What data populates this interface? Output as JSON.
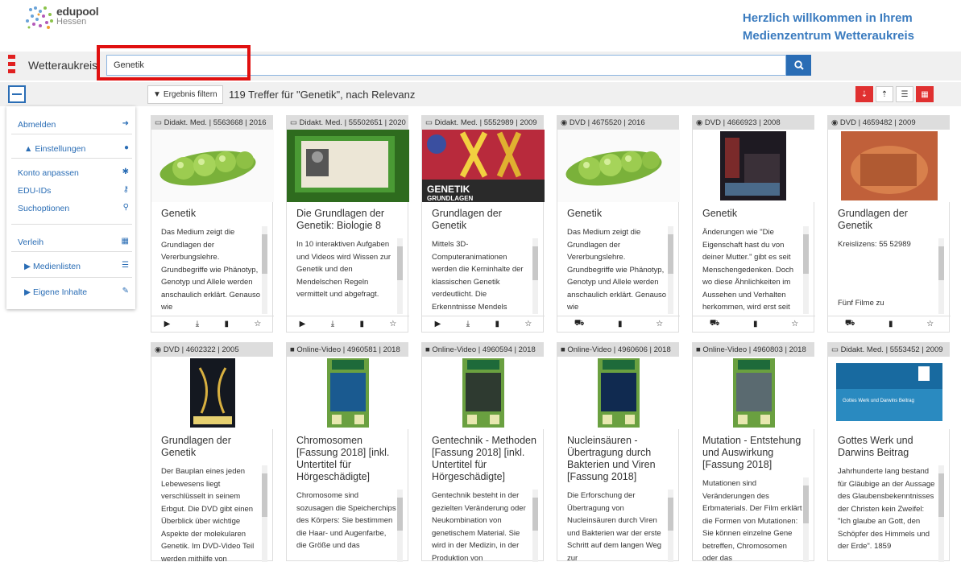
{
  "header": {
    "logo_name": "edupool",
    "logo_sub": "Hessen",
    "welcome_line1": "Herzlich willkommen in Ihrem",
    "welcome_line2": "Medienzentrum Wetteraukreis"
  },
  "search": {
    "region": "Wetteraukreis",
    "query": "Genetik"
  },
  "toolbar": {
    "filter_label": "Ergebnis filtern",
    "hits": "119 Treffer für \"Genetik\", nach Relevanz"
  },
  "sidebar": {
    "items": [
      {
        "label": "Abmelden",
        "icon": "sign-out-icon"
      },
      {
        "label": "Einstellungen",
        "icon": "user-icon"
      },
      {
        "label": "Konto anpassen",
        "icon": "gear-icon"
      },
      {
        "label": "EDU-IDs",
        "icon": "key-icon"
      },
      {
        "label": "Suchoptionen",
        "icon": "search-icon"
      },
      {
        "label": "Verleih",
        "icon": "calendar-icon"
      },
      {
        "label": "Medienlisten",
        "icon": "list-icon"
      },
      {
        "label": "Eigene Inhalte",
        "icon": "edit-icon"
      }
    ]
  },
  "cards": [
    {
      "head": "Didakt. Med. | 5563668 | 2016",
      "title": "Genetik",
      "desc": "Das Medium zeigt die Grundlagen der Vererbungslehre. Grundbegriffe wie Phänotyp, Genotyp und Allele werden anschaulich erklärt. Genauso wie",
      "type": "didakt"
    },
    {
      "head": "Didakt. Med. | 55502651 | 2020",
      "title": "Die Grundlagen der Genetik: Biologie 8",
      "desc": "In 10 interaktiven Aufgaben und Videos wird Wissen zur Genetik und den Mendelschen Regeln vermittelt und abgefragt.",
      "type": "didakt"
    },
    {
      "head": "Didakt. Med. | 5552989 | 2009",
      "title": "Grundlagen der Genetik",
      "desc": "Mittels 3D-Computeranimationen werden die Kerninhalte der klassischen Genetik verdeutlicht. Die Erkenntnisse Mendels",
      "type": "didakt",
      "img_text": "GENETIK",
      "img_sub": "GRUNDLAGEN"
    },
    {
      "head": "DVD | 4675520 | 2016",
      "title": "Genetik",
      "desc": "Das Medium zeigt die Grundlagen der Vererbungslehre. Grundbegriffe wie Phänotyp, Genotyp und Allele werden anschaulich erklärt. Genauso wie",
      "type": "dvd"
    },
    {
      "head": "DVD | 4666923 | 2008",
      "title": "Genetik",
      "desc": "Änderungen wie \"Die Eigenschaft hast du von deiner Mutter.\" gibt es seit Menschengedenken. Doch wo diese Ähnlichkeiten im Aussehen und Verhalten herkommen, wird erst seit",
      "type": "dvd"
    },
    {
      "head": "DVD | 4659482 | 2009",
      "title": "Grundlagen der Genetik",
      "desc": "Kreislizens: 55 52989",
      "desc2": "Fünf Filme zu",
      "type": "dvd"
    },
    {
      "head": "DVD | 4602322 | 2005",
      "title": "Grundlagen der Genetik",
      "desc": "Der Bauplan eines jeden Lebewesens liegt verschlüsselt in seinem Erbgut. Die DVD gibt einen Überblick über wichtige Aspekte der molekularen Genetik. Im DVD-Video Teil werden mithilfe von",
      "type": "dvd"
    },
    {
      "head": "Online-Video | 4960581 | 2018",
      "title": "Chromosomen [Fassung 2018] [inkl. Untertitel für Hörgeschädigte]",
      "desc": "Chromosome sind sozusagen die Speicherchips des Körpers: Sie bestimmen die Haar- und Augenfarbe, die Größe und das",
      "type": "video"
    },
    {
      "head": "Online-Video | 4960594 | 2018",
      "title": "Gentechnik - Methoden [Fassung 2018] [inkl. Untertitel für Hörgeschädigte]",
      "desc": "Gentechnik besteht in der gezielten Veränderung oder Neukombination von genetischem Material. Sie wird in der Medizin, in der Produktion von",
      "type": "video"
    },
    {
      "head": "Online-Video | 4960606 | 2018",
      "title": "Nucleinsäuren - Übertragung durch Bakterien und Viren [Fassung 2018]",
      "desc": "Die Erforschung der Übertragung von Nucleinsäuren durch Viren und Bakterien war der erste Schritt auf dem langen Weg zur",
      "type": "video"
    },
    {
      "head": "Online-Video | 4960803 | 2018",
      "title": "Mutation - Entstehung und Auswirkung [Fassung 2018]",
      "desc": "Mutationen sind Veränderungen des Erbmaterials. Der Film erklärt die Formen von Mutationen: Sie können einzelne Gene betreffen, Chromosomen oder das",
      "type": "video"
    },
    {
      "head": "Didakt. Med. | 5553452 | 2009",
      "title": "Gottes Werk und Darwins Beitrag",
      "desc": "Jahrhunderte lang bestand für Gläubige an der Aussage des Glaubensbekenntnisses der Christen kein Zweifel: \"Ich glaube an Gott, den Schöpfer des Himmels und der Erde\". 1859",
      "type": "didakt",
      "img_text": "Gottes Werk und Darwins Beitrag"
    }
  ]
}
